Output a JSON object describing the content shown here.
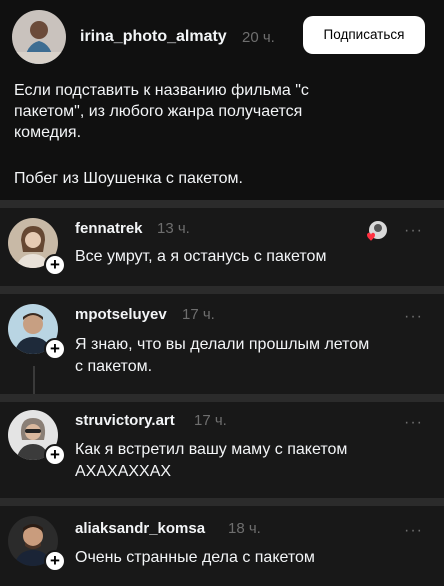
{
  "post": {
    "username": "irina_photo_almaty",
    "time": "20 ч.",
    "follow_label": "Подписаться",
    "text_lines": [
      "Если подставить к названию фильма \"с",
      "пакетом\", из любого жанра получается",
      "комедия."
    ],
    "text2": "Побег из Шоушенка с пакетом."
  },
  "replies": [
    {
      "username": "fennatrek",
      "time": "13 ч.",
      "more": "···",
      "lines": [
        "Все умрут, а я останусь с пакетом"
      ]
    },
    {
      "username": "mpotseluyev",
      "time": "17 ч.",
      "more": "···",
      "lines": [
        "Я знаю, что вы делали прошлым летом",
        "с пакетом."
      ]
    },
    {
      "username": "struvictory.art",
      "time": "17 ч.",
      "more": "···",
      "lines": [
        "Как я встретил вашу маму с пакетом",
        "АХАХАХХАХ"
      ]
    },
    {
      "username": "aliaksandr_komsa",
      "time": "18 ч.",
      "more": "···",
      "lines": [
        "Очень странные дела с пакетом"
      ]
    }
  ],
  "icons": {
    "add": "+"
  }
}
